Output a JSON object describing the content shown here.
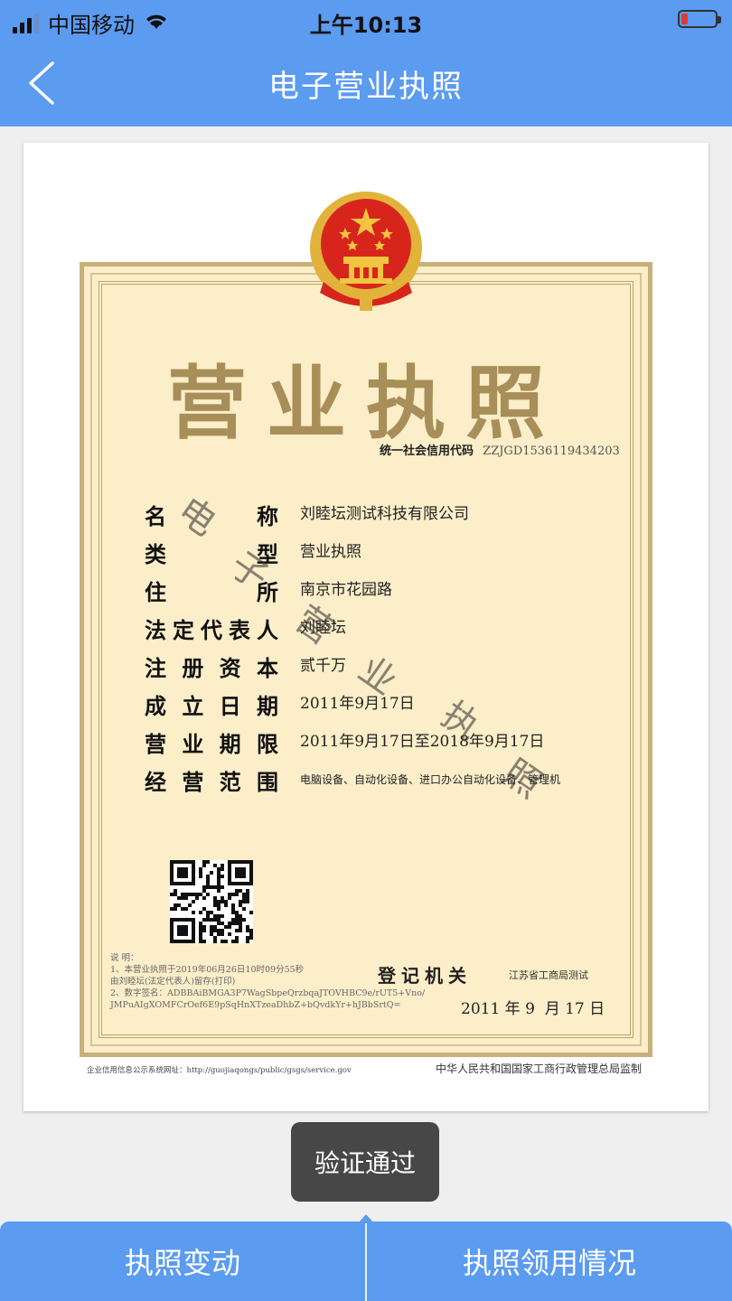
{
  "status_bar": {
    "carrier": "中国移动",
    "time": "上午10:13"
  },
  "nav": {
    "title": "电子营业执照"
  },
  "license": {
    "title": "营业执照",
    "credit_code_label": "统一社会信用代码",
    "credit_code": "ZZJGD1536119434203",
    "fields": [
      {
        "label": "名称",
        "value": "刘睦坛测试科技有限公司"
      },
      {
        "label": "类型",
        "value": "营业执照"
      },
      {
        "label": "住所",
        "value": "南京市花园路"
      },
      {
        "label": "法定代表人",
        "value": "刘睦坛"
      },
      {
        "label": "注册资本",
        "value": "贰千万"
      },
      {
        "label": "成立日期",
        "value": "2011年9月17日"
      },
      {
        "label": "营业期限",
        "value": "2011年9月17日至2018年9月17日"
      },
      {
        "label": "经营范围",
        "value": "电脑设备、自动化设备、进口办公自动化设备、管理机"
      }
    ],
    "note_lines": [
      "说  明：",
      "1、本营业执照于2019年06月26日10时09分55秒",
      "由刘睦坛(法定代表人)留存(打印)",
      "2、数字签名：ADBBAiBMGA3P7WagSbpeQrzbqaJTOVHBC9e/rUT5+Vno/",
      "JMPuAIgXOMFCrOef6E9pSqHnXTzeaDhbZ+bQvdkYr+hJBbSrtQ="
    ],
    "registration_authority_label": "登记机关",
    "registration_authority": "江苏省工商局测试",
    "issue_date": "2011 年 9  月 17 日",
    "footer_left": "企业信用信息公示系统网址：http://guojiaqongs/public/gsgs/service.gov",
    "footer_right": "中华人民共和国国家工商行政管理总局监制",
    "watermark": [
      "电",
      "子",
      "营",
      "业",
      "执",
      "照"
    ]
  },
  "toast": "验证通过",
  "tabs": {
    "left": "执照变动",
    "right": "执照领用情况"
  },
  "colors": {
    "accent": "#5b9bf0",
    "certificate_bg": "#fbeec9",
    "title_gold": "#a88e58",
    "emblem_red": "#d7251c",
    "emblem_gold": "#e2b33a"
  }
}
